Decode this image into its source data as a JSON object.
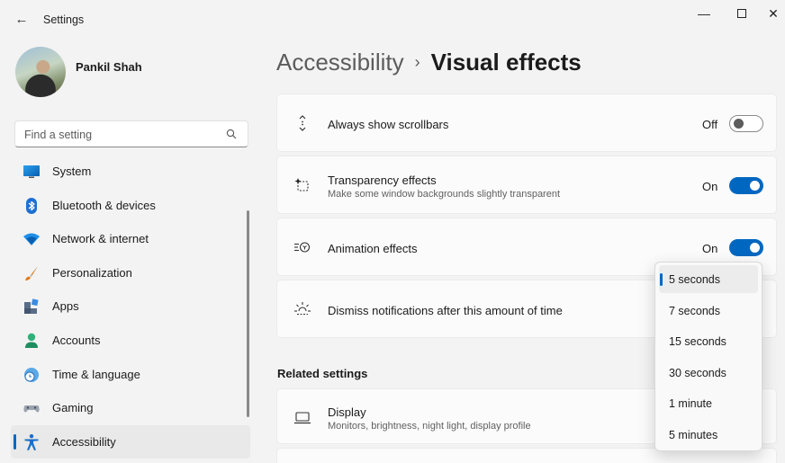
{
  "window": {
    "title": "Settings",
    "back_glyph": "←",
    "minimize_glyph": "—",
    "close_glyph": "✕"
  },
  "profile": {
    "name": "Pankil Shah"
  },
  "search": {
    "placeholder": "Find a setting"
  },
  "sidebar": {
    "items": [
      {
        "label": "System",
        "icon": "monitor-icon"
      },
      {
        "label": "Bluetooth & devices",
        "icon": "bluetooth-icon"
      },
      {
        "label": "Network & internet",
        "icon": "wifi-icon"
      },
      {
        "label": "Personalization",
        "icon": "brush-icon"
      },
      {
        "label": "Apps",
        "icon": "apps-icon"
      },
      {
        "label": "Accounts",
        "icon": "person-icon"
      },
      {
        "label": "Time & language",
        "icon": "globe-clock-icon"
      },
      {
        "label": "Gaming",
        "icon": "gamepad-icon"
      },
      {
        "label": "Accessibility",
        "icon": "accessibility-icon",
        "active": true
      }
    ]
  },
  "breadcrumb": {
    "parent": "Accessibility",
    "separator": "›",
    "current": "Visual effects"
  },
  "settings": {
    "scrollbars": {
      "title": "Always show scrollbars",
      "state": "Off",
      "icon": "scroll-arrows-icon"
    },
    "transparency": {
      "title": "Transparency effects",
      "subtitle": "Make some window backgrounds slightly transparent",
      "state": "On",
      "icon": "transparency-icon"
    },
    "animation": {
      "title": "Animation effects",
      "state": "On",
      "icon": "animation-icon"
    },
    "dismiss": {
      "title": "Dismiss notifications after this amount of time",
      "icon": "sun-timer-icon"
    }
  },
  "related": {
    "heading": "Related settings",
    "display": {
      "title": "Display",
      "subtitle": "Monitors, brightness, night light, display profile",
      "icon": "laptop-icon"
    }
  },
  "dropdown": {
    "selected": "5 seconds",
    "options": [
      "5 seconds",
      "7 seconds",
      "15 seconds",
      "30 seconds",
      "1 minute",
      "5 minutes"
    ]
  },
  "colors": {
    "accent": "#0067c0",
    "background": "#f3f3f3",
    "card": "#fbfbfb"
  }
}
